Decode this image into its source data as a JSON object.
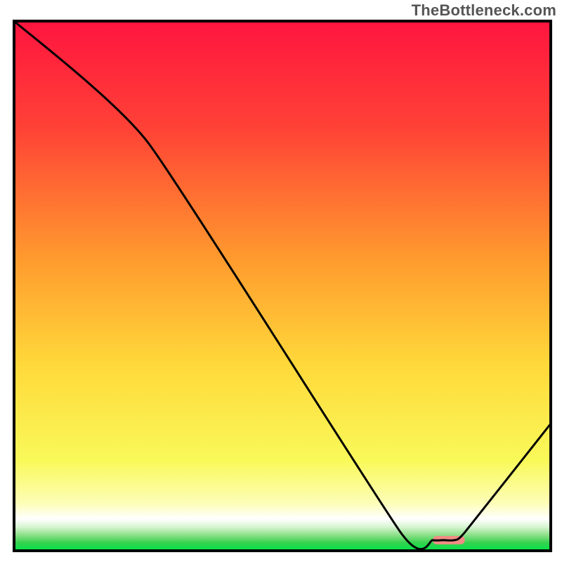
{
  "watermark": "TheBottleneck.com",
  "chart_data": {
    "type": "line",
    "title": "",
    "xlabel": "",
    "ylabel": "",
    "xlim": [
      0,
      100
    ],
    "ylim": [
      0,
      100
    ],
    "grid": false,
    "legend": false,
    "x": [
      0,
      25,
      72,
      78,
      80,
      82,
      84,
      100
    ],
    "values": [
      100,
      77,
      3.5,
      2,
      2,
      2,
      3.5,
      24
    ],
    "marker": {
      "x_start": 78,
      "x_end": 84,
      "y": 2,
      "color": "#f08d85"
    },
    "gradient_stops": [
      {
        "offset": 0.0,
        "color": "#ff153f"
      },
      {
        "offset": 0.2,
        "color": "#ff4136"
      },
      {
        "offset": 0.45,
        "color": "#ff9b2e"
      },
      {
        "offset": 0.65,
        "color": "#ffd93a"
      },
      {
        "offset": 0.83,
        "color": "#f9f95a"
      },
      {
        "offset": 0.91,
        "color": "#fdfdb7"
      },
      {
        "offset": 0.94,
        "color": "#ffffff"
      },
      {
        "offset": 0.955,
        "color": "#d7f5d2"
      },
      {
        "offset": 0.97,
        "color": "#8ee08a"
      },
      {
        "offset": 0.985,
        "color": "#35d24e"
      },
      {
        "offset": 1.0,
        "color": "#00e44a"
      }
    ]
  }
}
